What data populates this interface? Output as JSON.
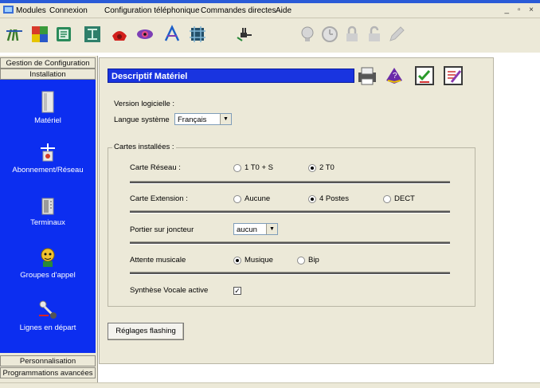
{
  "window": {
    "menus": [
      "Modules",
      "Connexion",
      "Configuration téléphonique",
      "Commandes directes",
      "Aide"
    ],
    "controls": "_ ▫ ×"
  },
  "toolbar": {
    "icons": [
      "antenna-icon",
      "puzzle-icon",
      "folder-icon",
      "network-tree-icon",
      "phone-icon",
      "eye-icon",
      "compass-icon",
      "chip-icon",
      "plug-icon",
      "light-bulb-icon",
      "clock-icon",
      "lock-icon",
      "lock-open-icon",
      "pencil-icon"
    ]
  },
  "sidebar": {
    "top": [
      "Gestion de Configuration",
      "Installation"
    ],
    "items": [
      {
        "label": "Matériel",
        "icon": "hardware-icon"
      },
      {
        "label": "Abonnement/Réseau",
        "icon": "network-icon"
      },
      {
        "label": "Terminaux",
        "icon": "terminal-icon"
      },
      {
        "label": "Groupes d'appel",
        "icon": "call-group-icon"
      },
      {
        "label": "Lignes en départ",
        "icon": "outgoing-line-icon"
      }
    ],
    "bottom": [
      "Personnalisation",
      "Programmations avancées"
    ]
  },
  "panel": {
    "title": "Descriptif Matériel",
    "version_label": "Version logicielle :",
    "language_label": "Langue système",
    "language_value": "Français",
    "group_label": "Cartes installées :",
    "network_card": {
      "label": "Carte Réseau :",
      "options": [
        "1 T0 + S",
        "2 T0"
      ],
      "selected": "2 T0"
    },
    "extension_card": {
      "label": "Carte Extension :",
      "options": [
        "Aucune",
        "4 Postes",
        "DECT"
      ],
      "selected": "4 Postes"
    },
    "portier": {
      "label": "Portier sur joncteur",
      "value": "aucun"
    },
    "music": {
      "label": "Attente musicale",
      "options": [
        "Musique",
        "Bip"
      ],
      "selected": "Musique"
    },
    "voice": {
      "label": "Synthèse Vocale active",
      "checked": true
    },
    "flash_button": "Réglages flashing"
  },
  "colors": {
    "nav_blue": "#0c2ef0",
    "title_blue": "#1934e0",
    "chrome": "#ece9d8"
  }
}
